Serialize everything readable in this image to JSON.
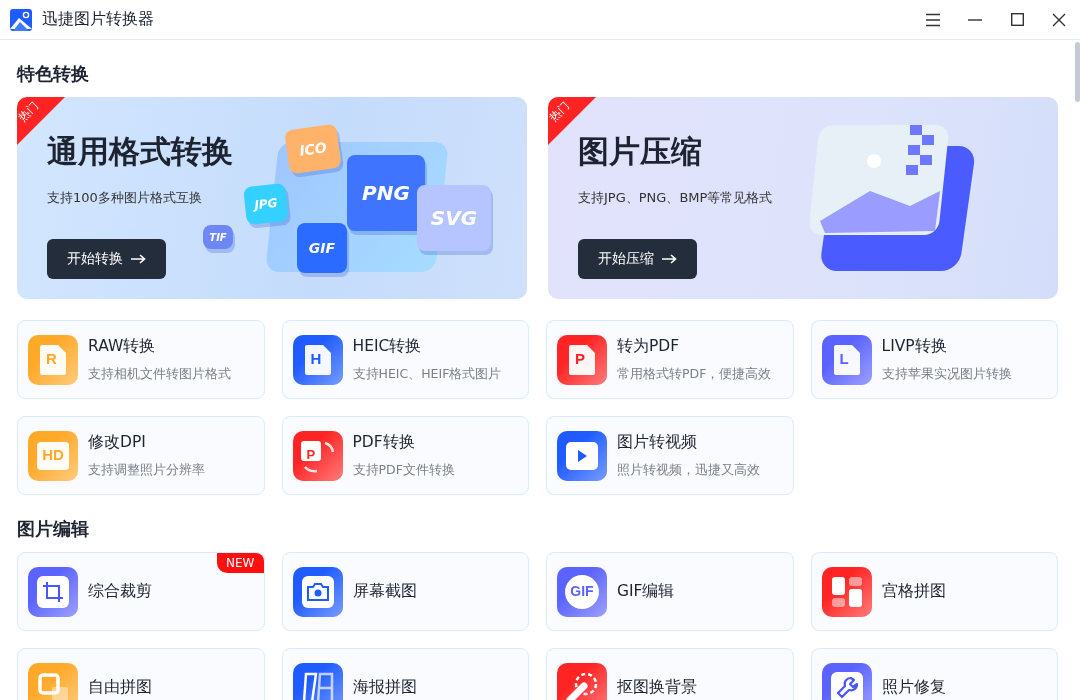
{
  "window": {
    "title": "迅捷图片转换器"
  },
  "sections": [
    {
      "title": "特色转换",
      "banners": [
        {
          "kind": "convert",
          "tag": "热门",
          "title": "通用格式转换",
          "subtitle": "支持100多种图片格式互换",
          "button": "开始转换",
          "illustration_labels": [
            "ICO",
            "PNG",
            "JPG",
            "SVG",
            "TIF",
            "GIF"
          ]
        },
        {
          "kind": "compress",
          "tag": "热门",
          "title": "图片压缩",
          "subtitle": "支持JPG、PNG、BMP等常见格式",
          "button": "开始压缩"
        }
      ],
      "cards": [
        {
          "kind": "doc",
          "icon_text": "R",
          "color": "#ffa928",
          "title": "RAW转换",
          "subtitle": "支持相机文件转图片格式"
        },
        {
          "kind": "doc",
          "icon_text": "H",
          "color": "#1f5bff",
          "title": "HEIC转换",
          "subtitle": "支持HEIC、HEIF格式图片"
        },
        {
          "kind": "doc",
          "icon_text": "P",
          "color": "#ff2424",
          "title": "转为PDF",
          "subtitle": "常用格式转PDF，便捷高效"
        },
        {
          "kind": "doc",
          "icon_text": "L",
          "color": "#5a62ff",
          "title": "LIVP转换",
          "subtitle": "支持苹果实况图片转换"
        },
        {
          "kind": "tile",
          "icon_text": "HD",
          "color": "#ffa928",
          "title": "修改DPI",
          "subtitle": "支持调整照片分辨率"
        },
        {
          "kind": "pdf",
          "icon_text": "P",
          "color": "#ff2424",
          "title": "PDF转换",
          "subtitle": "支持PDF文件转换"
        },
        {
          "kind": "play",
          "color": "#1f5bff",
          "title": "图片转视频",
          "subtitle": "照片转视频，迅捷又高效"
        }
      ]
    },
    {
      "title": "图片编辑",
      "cards": [
        {
          "kind": "crop",
          "color": "#5a62ff",
          "title": "综合裁剪",
          "badge": "NEW"
        },
        {
          "kind": "camera",
          "color": "#1f5bff",
          "title": "屏幕截图"
        },
        {
          "kind": "circle",
          "icon_text": "GIF",
          "color": "#5a62ff",
          "title": "GIF编辑"
        },
        {
          "kind": "grid",
          "color": "#ff2424",
          "title": "宫格拼图"
        },
        {
          "kind": "square",
          "color": "#ffa928",
          "title": "自由拼图"
        },
        {
          "kind": "poster",
          "color": "#1f5bff",
          "title": "海报拼图"
        },
        {
          "kind": "cutout",
          "color": "#ff2424",
          "title": "抠图换背景"
        },
        {
          "kind": "wrench",
          "color": "#5a62ff",
          "title": "照片修复"
        }
      ]
    }
  ]
}
